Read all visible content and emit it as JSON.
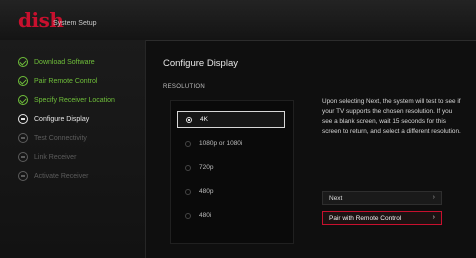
{
  "header": {
    "logo_text": "dish",
    "title": "System Setup",
    "brand_color": "#c8102e"
  },
  "sidebar": {
    "steps": [
      {
        "label": "Download Software",
        "state": "done",
        "icon": "check-circle-icon"
      },
      {
        "label": "Pair Remote Control",
        "state": "done",
        "icon": "check-circle-icon"
      },
      {
        "label": "Specify Receiver Location",
        "state": "done",
        "icon": "check-circle-icon"
      },
      {
        "label": "Configure Display",
        "state": "current",
        "icon": "minus-circle-icon"
      },
      {
        "label": "Test Connectivity",
        "state": "pending",
        "icon": "minus-circle-icon"
      },
      {
        "label": "Link Receiver",
        "state": "pending",
        "icon": "minus-circle-icon"
      },
      {
        "label": "Activate Receiver",
        "state": "pending",
        "icon": "minus-circle-icon"
      }
    ],
    "done_color": "#6fbf3a"
  },
  "main": {
    "title": "Configure Display",
    "section_label": "RESOLUTION",
    "resolutions": [
      {
        "label": "4K",
        "selected": true
      },
      {
        "label": "1080p or 1080i",
        "selected": false
      },
      {
        "label": "720p",
        "selected": false
      },
      {
        "label": "480p",
        "selected": false
      },
      {
        "label": "480i",
        "selected": false
      }
    ],
    "info_text": "Upon selecting Next, the system will test to see if your TV supports the chosen resolution. If you see a blank screen, wait 15 seconds for this screen to return, and select a different resolution.",
    "buttons": {
      "next_label": "Next",
      "pair_label": "Pair with Remote Control"
    }
  }
}
